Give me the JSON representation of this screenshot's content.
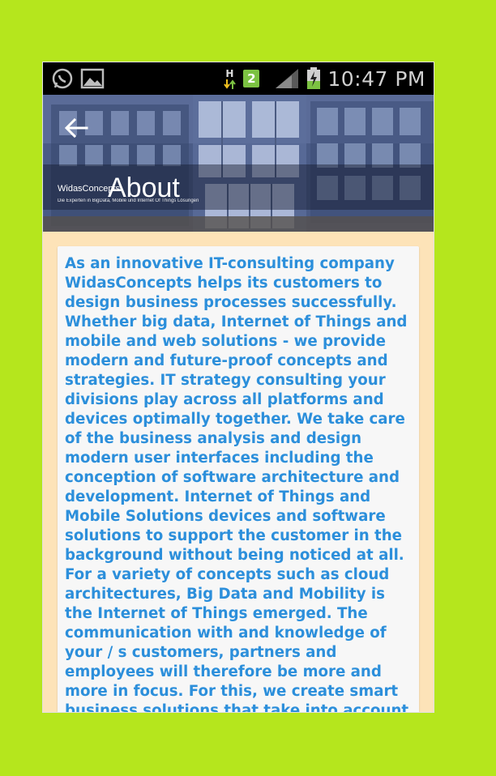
{
  "status_bar": {
    "time": "10:47 PM",
    "notification_badge": "2",
    "network_type": "H",
    "icons": [
      "whatsapp-icon",
      "image-icon",
      "network-h-icon",
      "badge-icon",
      "signal-icon",
      "battery-charging-icon"
    ]
  },
  "header": {
    "title": "About",
    "logo_name": "WidasConcepts",
    "logo_tagline": "Die Experten in BigData, Mobile und Internet Of Things Lösungen",
    "back_icon": "back-arrow-icon"
  },
  "content": {
    "text": "As an innovative IT-consulting company WidasConcepts helps its customers to design business processes successfully. Whether big data, Internet of Things and mobile and web solutions - we provide modern and future-proof concepts and strategies. IT strategy consulting your divisions play across all platforms and devices optimally together. We take care of the business analysis and design modern user interfaces including the conception of software architecture and development. Internet of Things and Mobile Solutions devices and software solutions to support the customer in the background without being noticed at all. For a variety of concepts such as cloud architectures, Big Data and Mobility is the Internet of Things emerged. The communication with and knowledge of your / s customers, partners and employees will therefore be more and more in focus. For this, we create smart business solutions that take into account the context of the user, its mobility and local intelligence and inspire"
  },
  "colors": {
    "page_background": "#b5e61d",
    "content_background": "#fde3b8",
    "text_color": "#2c8fdb",
    "card_background": "#f7f7f7"
  }
}
